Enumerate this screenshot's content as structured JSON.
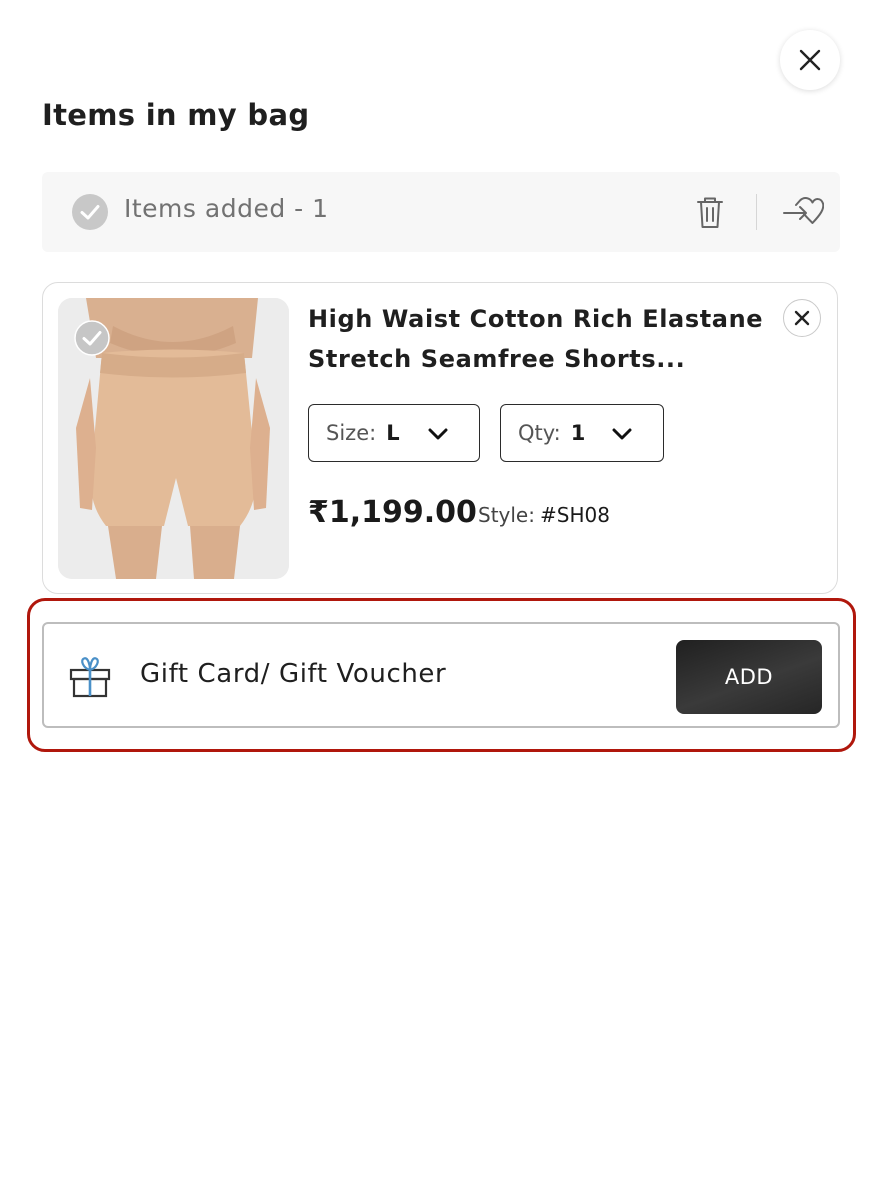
{
  "panel": {
    "title": "Items in my bag",
    "close_icon": "close-icon"
  },
  "bag_bar": {
    "items_added_label": "Items added - 1",
    "icons": [
      "check-circle-icon",
      "trash-icon",
      "move-to-wishlist-icon"
    ]
  },
  "item": {
    "name": "High Waist Cotton Rich Elastane Stretch Seamfree Shorts...",
    "size_label": "Size:",
    "size_value": "L",
    "qty_label": "Qty:",
    "qty_value": "1",
    "price": "₹1,199.00",
    "style_label": "Style:",
    "style_value": "#SH08",
    "selected": true
  },
  "gift": {
    "label": "Gift Card/ Gift Voucher",
    "add_label": "ADD",
    "icon": "gift-icon"
  },
  "colors": {
    "highlight_border": "#b0170c",
    "add_button": "#2a2a2a",
    "gift_icon_accent": "#4a90c8",
    "check_icon": "#c8c8c8"
  }
}
